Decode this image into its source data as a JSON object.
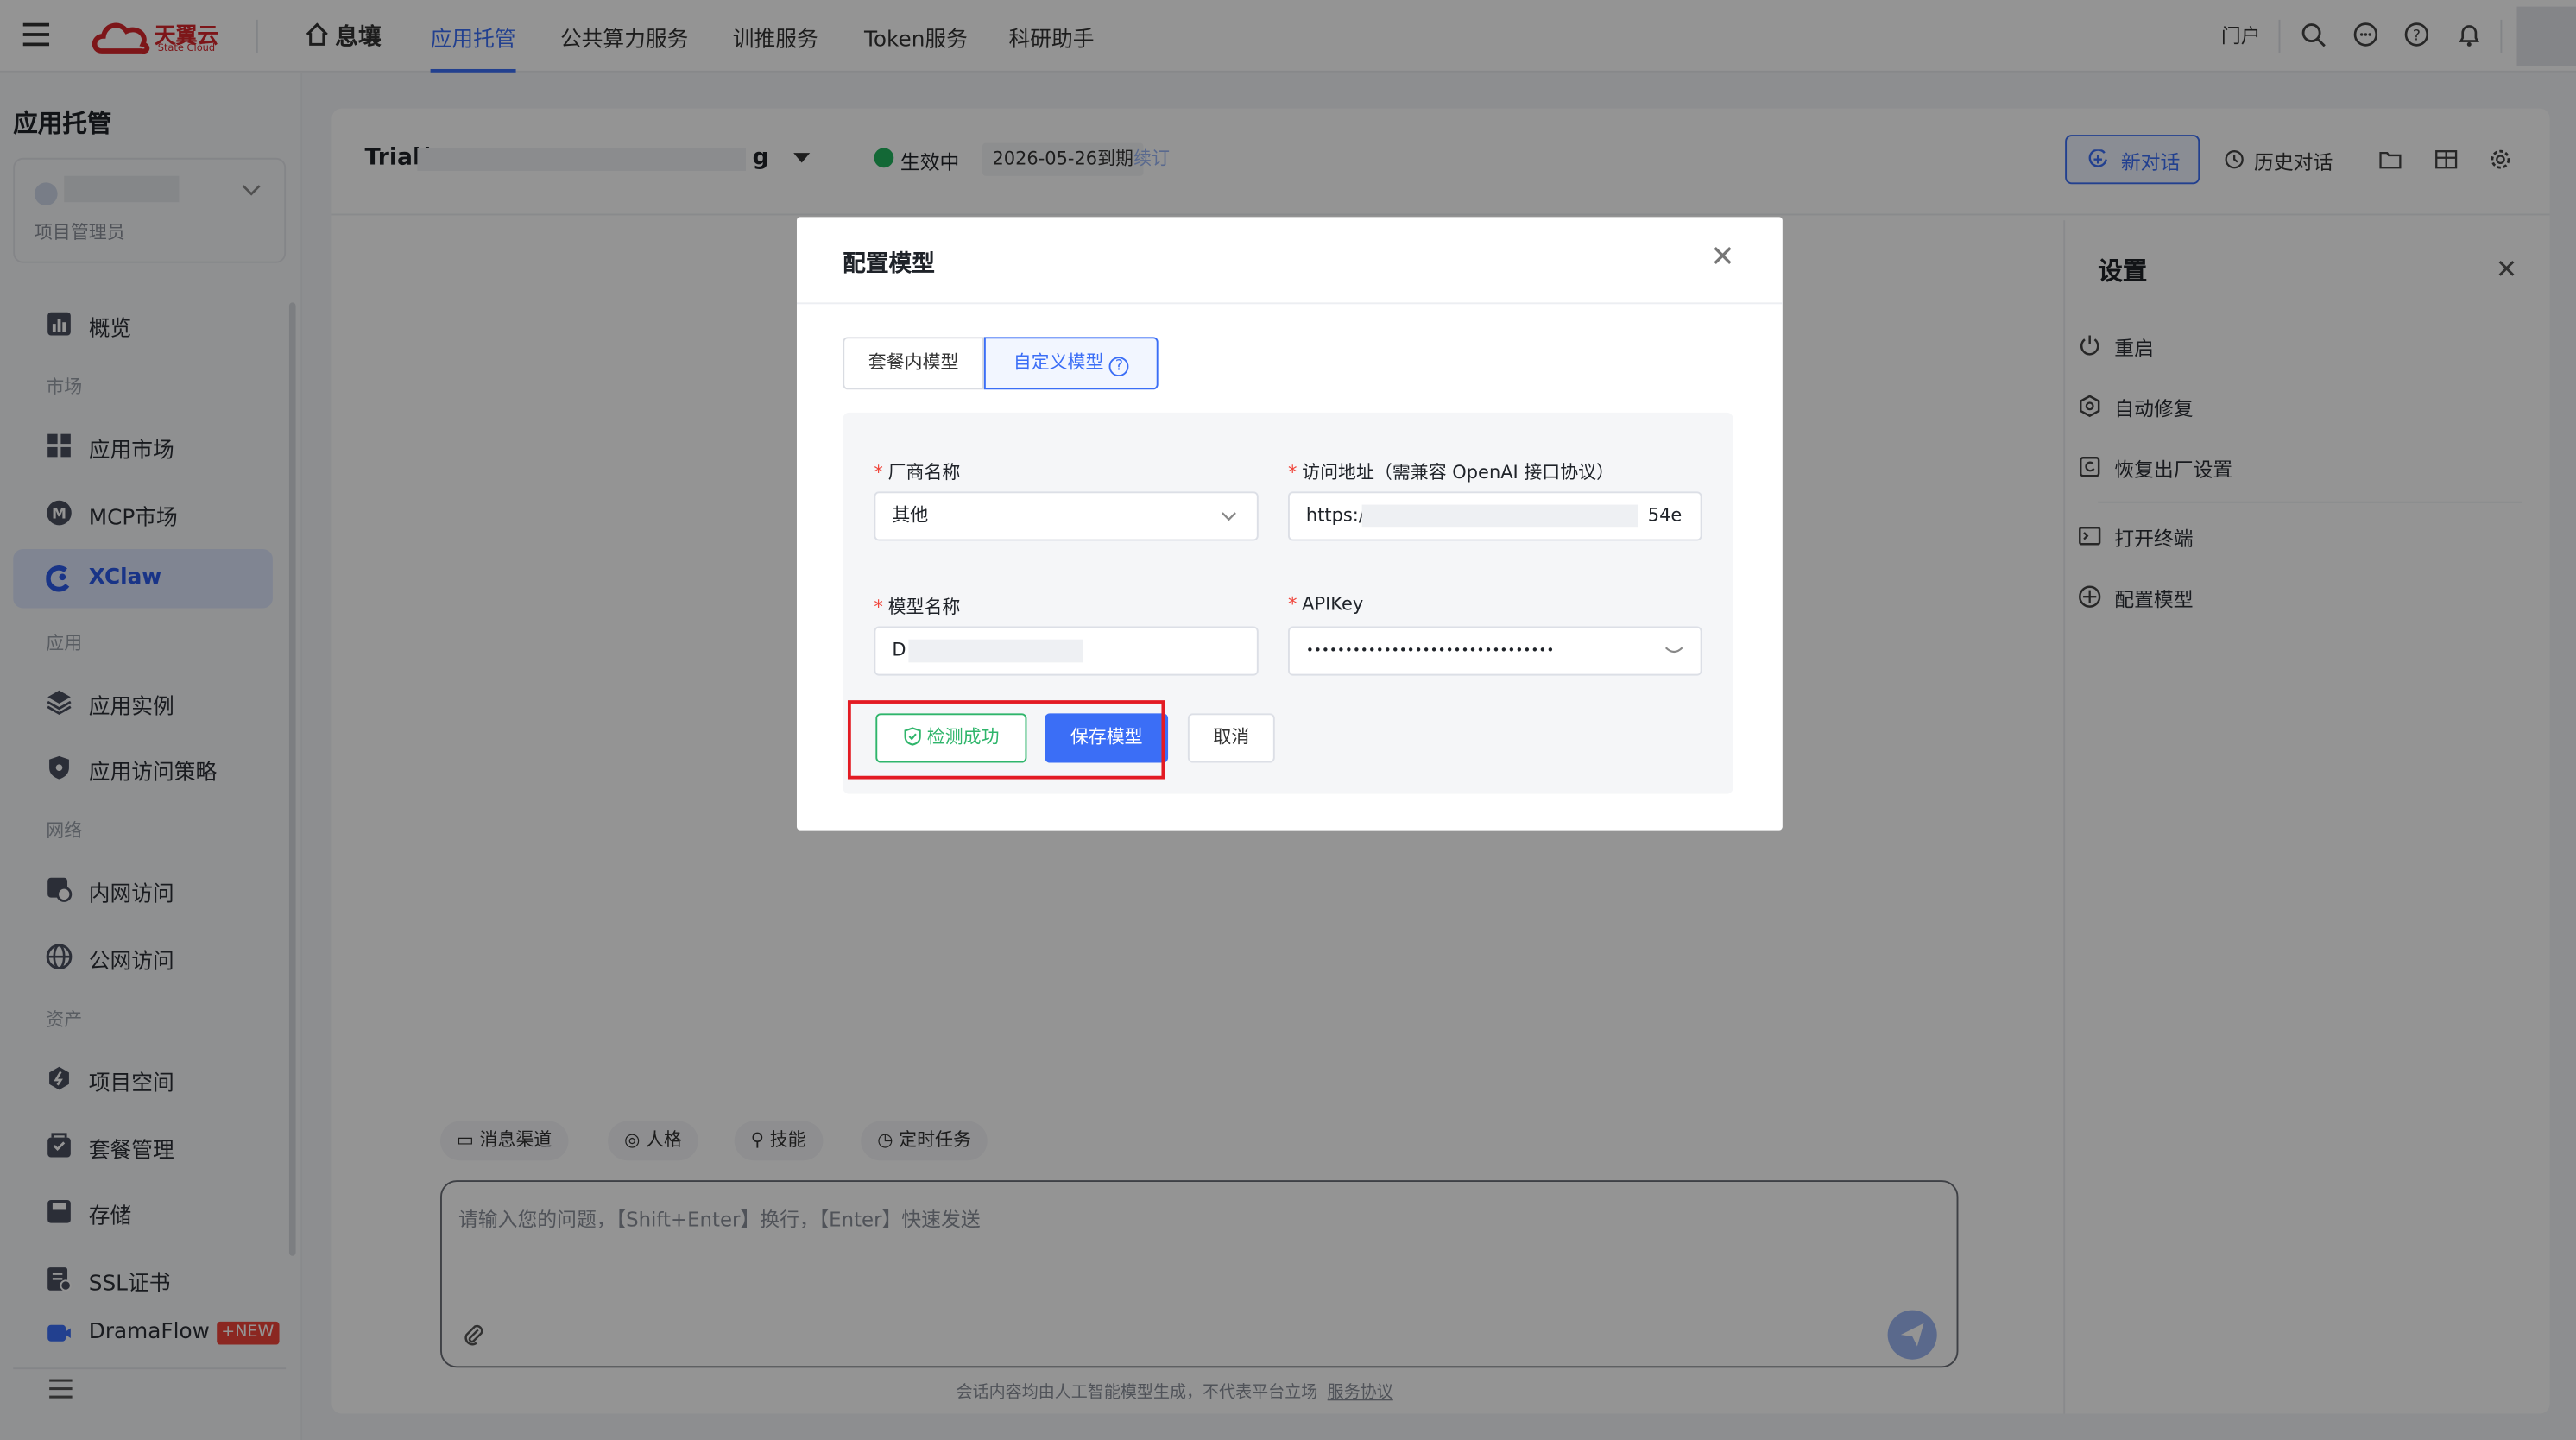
{
  "header": {
    "logo_text": "天翼云",
    "logo_sub": "State Cloud",
    "brand_name": "息壤",
    "nav": [
      "应用托管",
      "公共算力服务",
      "训推服务",
      "Token服务",
      "科研助手"
    ],
    "portal": "门户"
  },
  "sidebar": {
    "title": "应用托管",
    "project_role": "项目管理员",
    "overview": "概览",
    "section_market": "市场",
    "app_market": "应用市场",
    "mcp_market": "MCP市场",
    "xclaw": "XClaw",
    "section_app": "应用",
    "app_instance": "应用实例",
    "app_access_policy": "应用访问策略",
    "section_network": "网络",
    "intranet": "内网访问",
    "internet": "公网访问",
    "section_assets": "资产",
    "project_space": "项目空间",
    "plan_mgmt": "套餐管理",
    "storage": "存储",
    "ssl": "SSL证书",
    "dramaflow": "DramaFlow",
    "new_badge": "NEW"
  },
  "main": {
    "instance_prefix": "Trial(",
    "instance_suffix": "g",
    "status": "生效中",
    "expire": "2026-05-26到期",
    "renew": "续订",
    "new_chat": "新对话",
    "history_chat": "历史对话",
    "chips": [
      "消息渠道",
      "人格",
      "技能",
      "定时任务"
    ],
    "chat_placeholder": "请输入您的问题，【Shift+Enter】换行，【Enter】快速发送",
    "disclaimer": "会话内容均由人工智能模型生成，不代表平台立场",
    "service_agreement": "服务协议"
  },
  "settings": {
    "title": "设置",
    "items": [
      "重启",
      "自动修复",
      "恢复出厂设置",
      "打开终端",
      "配置模型"
    ]
  },
  "modal": {
    "title": "配置模型",
    "tab_builtin": "套餐内模型",
    "tab_custom": "自定义模型",
    "vendor_label": "厂商名称",
    "vendor_value": "其他",
    "url_label": "访问地址（需兼容 OpenAI 接口协议）",
    "url_prefix": "https:/",
    "url_suffix": "54e",
    "model_label": "模型名称",
    "model_value_prefix": "D",
    "apikey_label": "APIKey",
    "apikey_value": "••••••••••••••••••••••••••••••••",
    "btn_check": "检测成功",
    "btn_save": "保存模型",
    "btn_cancel": "取消"
  },
  "colors": {
    "accent": "#3b6ef6",
    "success": "#2fb56b",
    "highlight_box": "#e31b23"
  }
}
